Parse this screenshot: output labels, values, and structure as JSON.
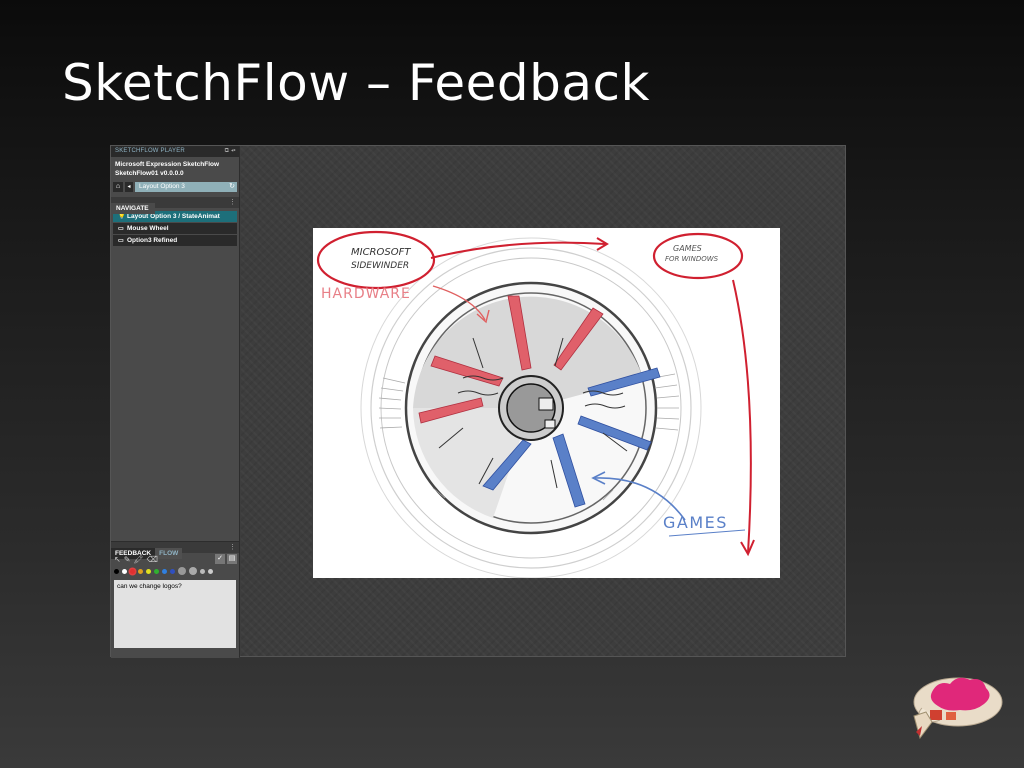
{
  "slide": {
    "title": "SketchFlow – Feedback"
  },
  "player": {
    "header": "SKETCHFLOW PLAYER",
    "header_icons": "⧉ ◂▸",
    "app_name": "Microsoft Expression SketchFlow",
    "project": "SketchFlow01 v0.0.0.0",
    "layout_field": "Layout Option 3"
  },
  "navigate": {
    "tab": "NAVIGATE",
    "items": [
      {
        "label": "Layout Option 3 / StateAnimat",
        "icon": "lightbulb-icon",
        "active": true
      },
      {
        "label": "Mouse Wheel",
        "icon": "screen-icon",
        "active": false
      },
      {
        "label": "Option3 Refined",
        "icon": "screen-icon",
        "active": false
      }
    ]
  },
  "feedback": {
    "tabs": [
      "FEEDBACK",
      "FLOW"
    ],
    "active_tab": "FEEDBACK",
    "text": "can we change logos?",
    "colors": [
      "#000000",
      "#ffffff",
      "#e03030",
      "#e0a020",
      "#e0e020",
      "#30b030",
      "#3080e0",
      "#3050c0",
      "#999999",
      "#aaaaaa",
      "#bbbbbb",
      "#cccccc"
    ]
  },
  "sketch": {
    "labels": {
      "microsoft": "MICROSOFT",
      "sidewinder": "SIDEWINDER",
      "hardware": "HARDWARE",
      "games_windows_1": "GAMES",
      "games_windows_2": "FOR WINDOWS",
      "games": "GAMES"
    },
    "accent_red": "#e0606a",
    "accent_blue": "#5a80c8",
    "ink_red": "#d02030"
  }
}
